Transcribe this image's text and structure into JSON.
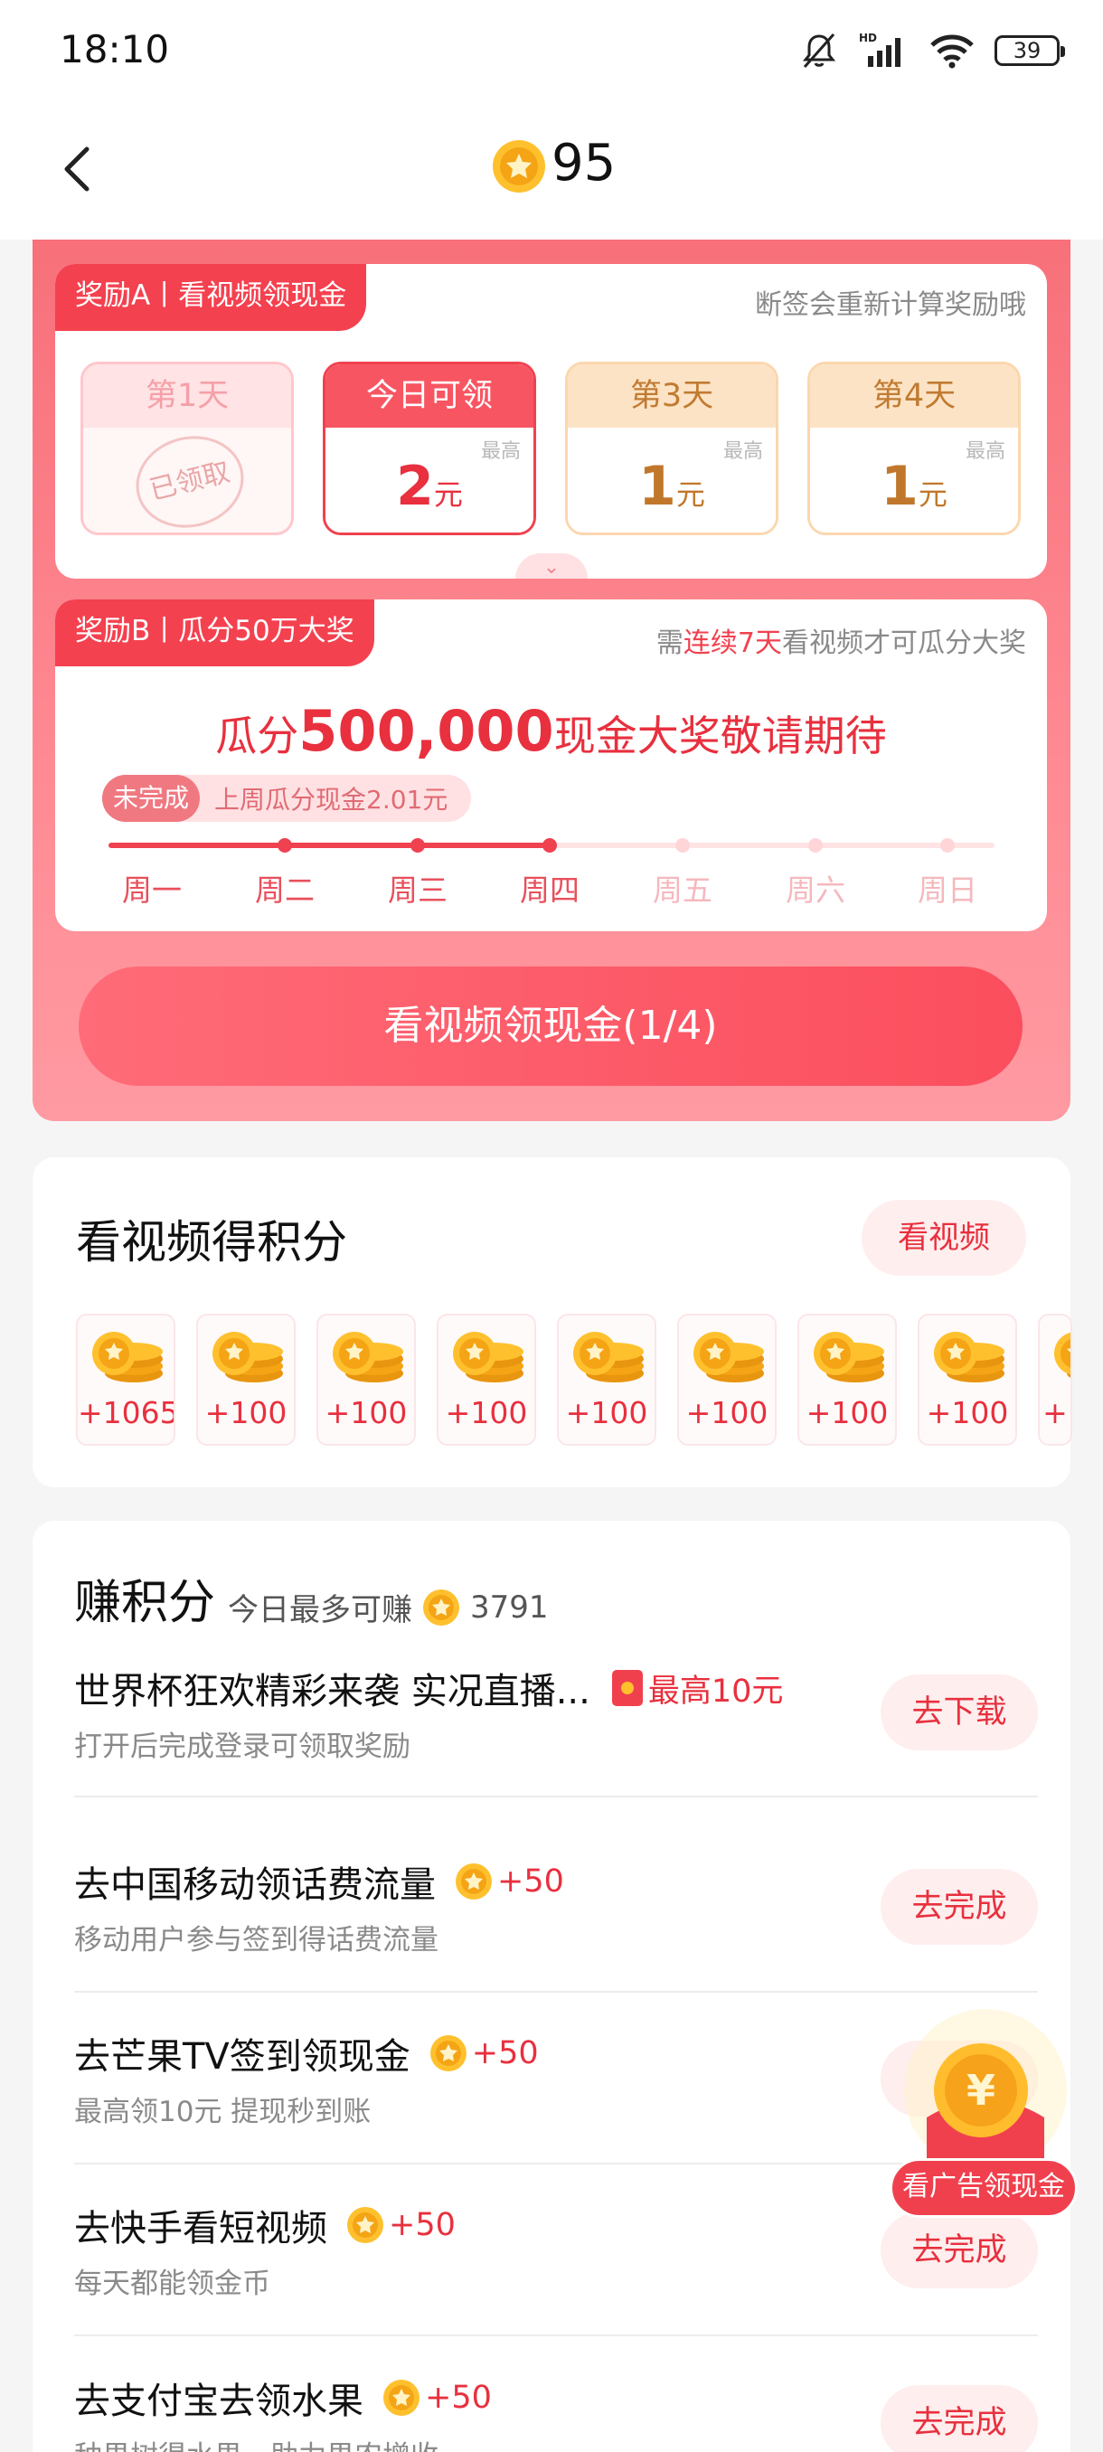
{
  "status": {
    "time": "18:10",
    "battery": "39",
    "network": "HD"
  },
  "header": {
    "coins": "95"
  },
  "rewardA": {
    "tag": "奖励A丨看视频领现金",
    "hint": "断签会重新计算奖励哦",
    "days": [
      {
        "label": "第1天",
        "stamp": "已领取"
      },
      {
        "label": "今日可领",
        "max": "最高",
        "amount": "2",
        "unit": "元"
      },
      {
        "label": "第3天",
        "max": "最高",
        "amount": "1",
        "unit": "元"
      },
      {
        "label": "第4天",
        "max": "最高",
        "amount": "1",
        "unit": "元"
      }
    ]
  },
  "rewardB": {
    "tag": "奖励B丨瓜分50万大奖",
    "hint_a": "需",
    "hint_b": "连续7天",
    "hint_c": "看视频才可瓜分大奖",
    "line_a": "瓜分",
    "line_num": "500,000",
    "line_b": "现金大奖敬请期待",
    "status": "未完成",
    "last_week": "上周瓜分现金2.01元",
    "weekdays": [
      "周一",
      "周二",
      "周三",
      "周四",
      "周五",
      "周六",
      "周日"
    ],
    "progress_done": 4
  },
  "cta": "看视频领现金(1/4)",
  "points": {
    "title": "看视频得积分",
    "button": "看视频",
    "items": [
      "+1065",
      "+100",
      "+100",
      "+100",
      "+100",
      "+100",
      "+100",
      "+100",
      "+"
    ]
  },
  "earn": {
    "title": "赚积分",
    "subtitle": "今日最多可赚",
    "max": "3791",
    "tasks": [
      {
        "title": "世界杯狂欢精彩来袭 实况直播...",
        "bonus": "最高10元",
        "desc": "打开后完成登录可领取奖励",
        "button": "去下载"
      },
      {
        "title": "去中国移动领话费流量",
        "bonus": "+50",
        "desc": "移动用户参与签到得话费流量",
        "button": "去完成"
      },
      {
        "title": "去芒果TV签到领现金",
        "bonus": "+50",
        "desc": "最高领10元 提现秒到账",
        "button": "去"
      },
      {
        "title": "去快手看短视频",
        "bonus": "+50",
        "desc": "每天都能领金币",
        "button": "去完成"
      },
      {
        "title": "去支付宝去领水果",
        "bonus": "+50",
        "desc": "种果树得水果，助力果农增收",
        "button": "去完成"
      }
    ]
  },
  "float_ad": {
    "label": "看广告领现金"
  },
  "colors": {
    "primary": "#f0414f",
    "accent": "#e8303e",
    "gold": "#c1772b"
  }
}
